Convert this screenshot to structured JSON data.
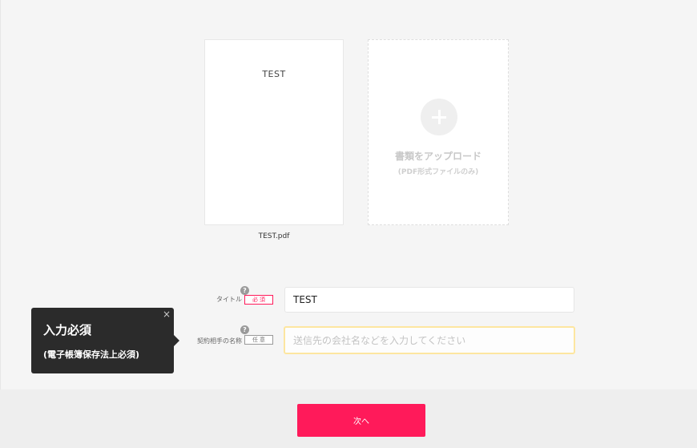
{
  "document": {
    "preview_text": "TEST",
    "filename": "TEST.pdf"
  },
  "upload": {
    "icon": "plus-icon",
    "label": "書類をアップロード",
    "sub": "(PDF形式ファイルのみ)"
  },
  "fields": {
    "title": {
      "label": "タイトル",
      "badge": "必須",
      "help": "?",
      "value": "TEST"
    },
    "counterparty": {
      "label": "契約相手の名称",
      "badge": "任意",
      "help": "?",
      "placeholder": "送信先の会社名などを入力してください",
      "value": ""
    }
  },
  "tooltip": {
    "title": "入力必須",
    "sub": "(電子帳簿保存法上必須)",
    "close": "×"
  },
  "footer": {
    "next_label": "次へ"
  },
  "colors": {
    "accent": "#ff1a5a",
    "tooltip_bg": "#2b2b2b",
    "focus_border": "#fde6a0"
  }
}
